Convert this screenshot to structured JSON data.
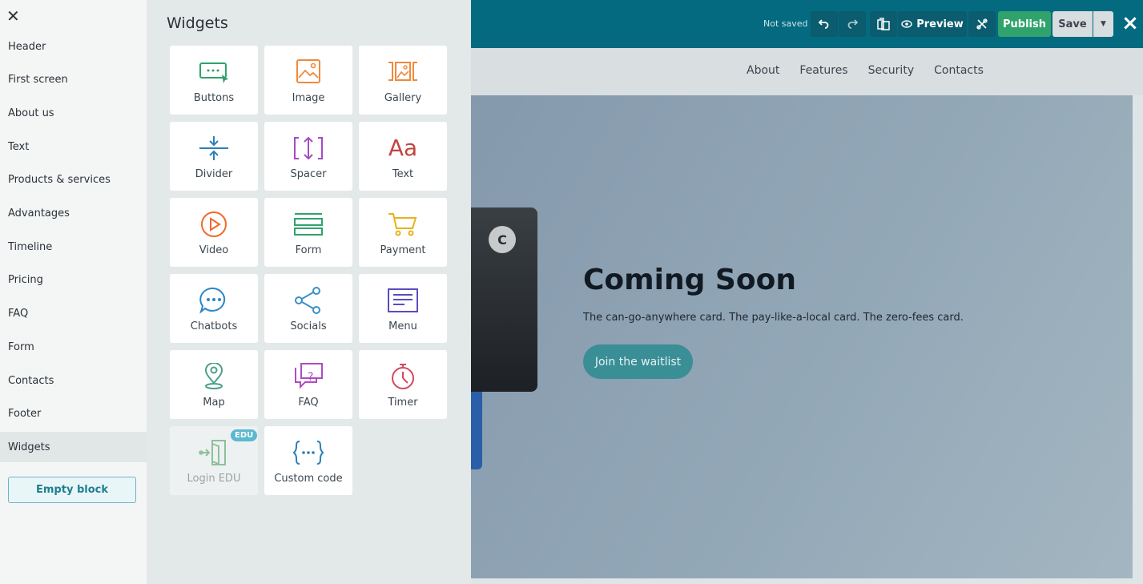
{
  "topbar": {
    "status": "Not saved",
    "preview_label": "Preview",
    "publish_label": "Publish",
    "save_label": "Save",
    "close_icon": "×"
  },
  "leftnav": {
    "close_icon": "✕",
    "items": [
      {
        "label": "Header"
      },
      {
        "label": "First screen"
      },
      {
        "label": "About us"
      },
      {
        "label": "Text"
      },
      {
        "label": "Products & services"
      },
      {
        "label": "Advantages"
      },
      {
        "label": "Timeline"
      },
      {
        "label": "Pricing"
      },
      {
        "label": "FAQ"
      },
      {
        "label": "Form"
      },
      {
        "label": "Contacts"
      },
      {
        "label": "Footer"
      },
      {
        "label": "Widgets",
        "active": true
      }
    ],
    "empty_block_label": "Empty block"
  },
  "widgets": {
    "title": "Widgets",
    "tiles": [
      {
        "label": "Buttons",
        "icon": "buttons-icon",
        "color": "#2fa36b"
      },
      {
        "label": "Image",
        "icon": "image-icon",
        "color": "#f08a3c"
      },
      {
        "label": "Gallery",
        "icon": "gallery-icon",
        "color": "#f08a3c"
      },
      {
        "label": "Divider",
        "icon": "divider-icon",
        "color": "#2b7fb8"
      },
      {
        "label": "Spacer",
        "icon": "spacer-icon",
        "color": "#a44bc4"
      },
      {
        "label": "Text",
        "icon": "text-icon",
        "color": "#c2453f"
      },
      {
        "label": "Video",
        "icon": "video-icon",
        "color": "#f06a2a"
      },
      {
        "label": "Form",
        "icon": "form-icon",
        "color": "#2fa36b"
      },
      {
        "label": "Payment",
        "icon": "cart-icon",
        "color": "#e8b21a"
      },
      {
        "label": "Chatbots",
        "icon": "chat-icon",
        "color": "#2b86c8"
      },
      {
        "label": "Socials",
        "icon": "share-icon",
        "color": "#3a8ec9"
      },
      {
        "label": "Menu",
        "icon": "menu-icon",
        "color": "#5a4cc0"
      },
      {
        "label": "Map",
        "icon": "map-pin-icon",
        "color": "#4aa08a"
      },
      {
        "label": "FAQ",
        "icon": "faq-icon",
        "color": "#b04bc4"
      },
      {
        "label": "Timer",
        "icon": "timer-icon",
        "color": "#d6475a"
      },
      {
        "label": "Login EDU",
        "icon": "login-icon",
        "color": "#8fc09a",
        "badge": "EDU",
        "disabled": true
      },
      {
        "label": "Custom code",
        "icon": "code-icon",
        "color": "#2b7fb8"
      }
    ]
  },
  "site": {
    "nav": [
      "About",
      "Features",
      "Security",
      "Contacts"
    ],
    "card_letter": "C",
    "hero_title": "Coming Soon",
    "hero_sub": "The can-go-anywhere card. The pay-like-a-local card. The zero-fees card.",
    "cta_label": "Join the waitlist"
  }
}
